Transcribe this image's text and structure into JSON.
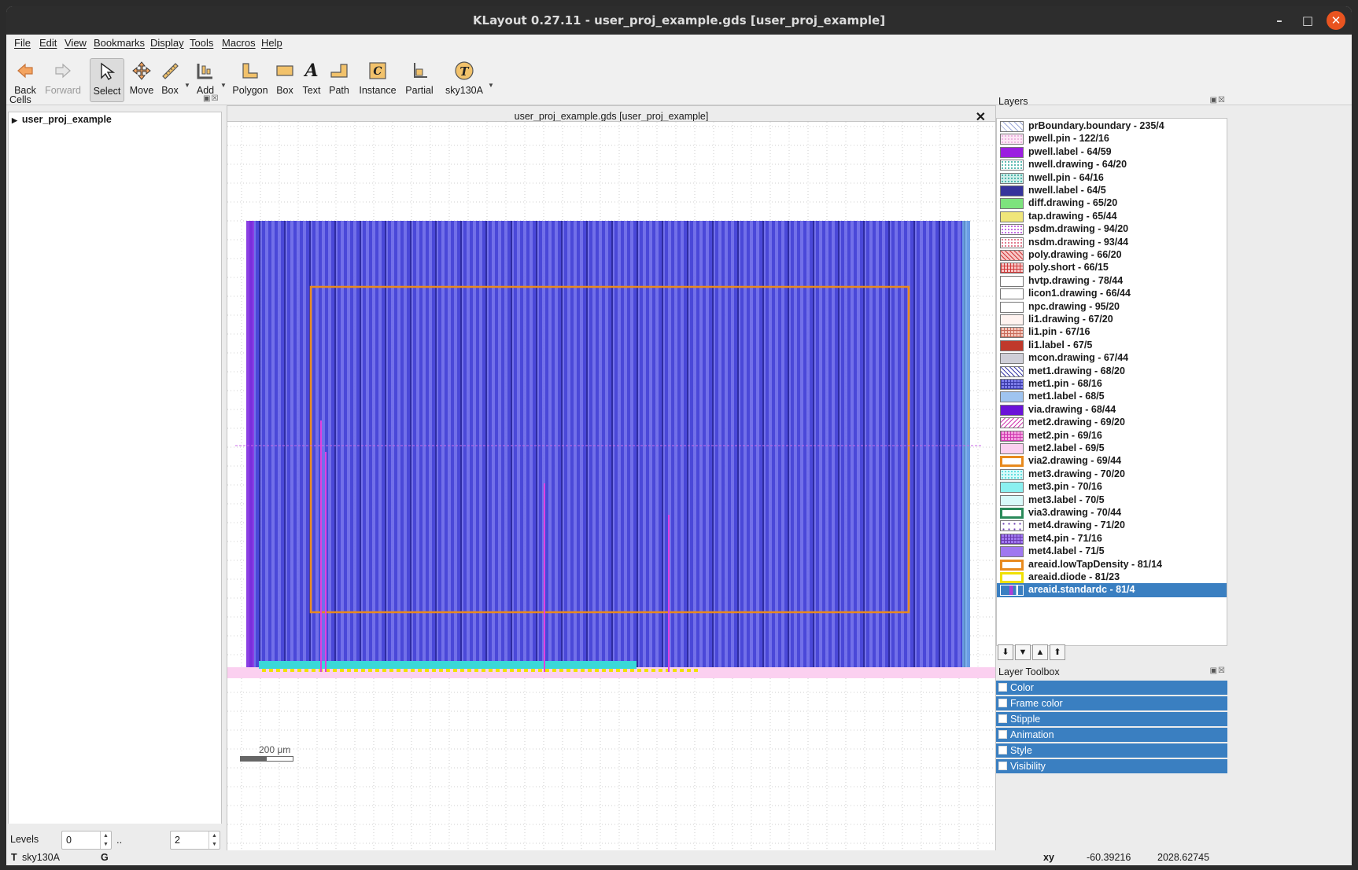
{
  "window": {
    "title": "KLayout 0.27.11 - user_proj_example.gds [user_proj_example]"
  },
  "menu": [
    "File",
    "Edit",
    "View",
    "Bookmarks",
    "Display",
    "Tools",
    "Macros",
    "Help"
  ],
  "toolbar": {
    "back": "Back",
    "forward": "Forward",
    "select": "Select",
    "move": "Move",
    "box": "Box",
    "add": "Add",
    "polygon": "Polygon",
    "box2": "Box",
    "text": "Text",
    "path": "Path",
    "instance": "Instance",
    "partial": "Partial",
    "tech": "sky130A"
  },
  "cells": {
    "title": "Cells",
    "root": "user_proj_example"
  },
  "levels": {
    "label": "Levels",
    "from": "0",
    "sep": "..",
    "to": "2"
  },
  "view": {
    "tab_title": "user_proj_example.gds [user_proj_example]",
    "scale_label": "200  μm"
  },
  "layers": {
    "title": "Layers",
    "items": [
      {
        "label": "prBoundary.boundary - 235/4",
        "fill": "#ffffff",
        "pattern": "diag-light",
        "color": "#9aa7d8"
      },
      {
        "label": "pwell.pin - 122/16",
        "fill": "#fde7f6",
        "pattern": "dots",
        "color": "#e8a6d8"
      },
      {
        "label": "pwell.label - 64/59",
        "fill": "#9b1ee0",
        "pattern": "solid",
        "color": "#9b1ee0"
      },
      {
        "label": "nwell.drawing - 64/20",
        "fill": "#ffffff",
        "pattern": "dots",
        "color": "#2aa59a"
      },
      {
        "label": "nwell.pin - 64/16",
        "fill": "#cdeee9",
        "pattern": "dots",
        "color": "#2aa59a"
      },
      {
        "label": "nwell.label - 64/5",
        "fill": "#36339b",
        "pattern": "solid",
        "color": "#36339b"
      },
      {
        "label": "diff.drawing - 65/20",
        "fill": "#7de37d",
        "pattern": "solid",
        "color": "#2eaf2e"
      },
      {
        "label": "tap.drawing - 65/44",
        "fill": "#f0e67a",
        "pattern": "solid",
        "color": "#c8b43c"
      },
      {
        "label": "psdm.drawing - 94/20",
        "fill": "#ffffff",
        "pattern": "dots",
        "color": "#b23cd8"
      },
      {
        "label": "nsdm.drawing - 93/44",
        "fill": "#ffffff",
        "pattern": "dots",
        "color": "#d8506a"
      },
      {
        "label": "poly.drawing - 66/20",
        "fill": "#f7c6c6",
        "pattern": "diag",
        "color": "#d03a3a"
      },
      {
        "label": "poly.short - 66/15",
        "fill": "#f7c6c6",
        "pattern": "grid",
        "color": "#d03a3a"
      },
      {
        "label": "hvtp.drawing - 78/44",
        "fill": "#ffffff",
        "pattern": "solid",
        "color": "#e8a04a"
      },
      {
        "label": "licon1.drawing - 66/44",
        "fill": "#ffffff",
        "pattern": "solid",
        "color": "#f7f3b0"
      },
      {
        "label": "npc.drawing - 95/20",
        "fill": "#ffffff",
        "pattern": "solid",
        "color": "#d04a4a"
      },
      {
        "label": "li1.drawing - 67/20",
        "fill": "#fff3f0",
        "pattern": "solid",
        "color": "#f0d8d0"
      },
      {
        "label": "li1.pin - 67/16",
        "fill": "#f4c4b8",
        "pattern": "grid",
        "color": "#c86a5a"
      },
      {
        "label": "li1.label - 67/5",
        "fill": "#c0392b",
        "pattern": "solid",
        "color": "#c0392b"
      },
      {
        "label": "mcon.drawing - 67/44",
        "fill": "#cfcfd8",
        "pattern": "solid",
        "color": "#a0a0b0"
      },
      {
        "label": "met1.drawing - 68/20",
        "fill": "#ffffff",
        "pattern": "diag",
        "color": "#3a3aa8"
      },
      {
        "label": "met1.pin - 68/16",
        "fill": "#7c7ce8",
        "pattern": "grid",
        "color": "#3a3aa8"
      },
      {
        "label": "met1.label - 68/5",
        "fill": "#9fc4f0",
        "pattern": "solid",
        "color": "#6a9ad8"
      },
      {
        "label": "via.drawing - 68/44",
        "fill": "#6a12d8",
        "pattern": "solid",
        "color": "#4a0ab0"
      },
      {
        "label": "met2.drawing - 69/20",
        "fill": "#ffffff",
        "pattern": "diag-rev",
        "color": "#d03ab0"
      },
      {
        "label": "met2.pin - 69/16",
        "fill": "#f4a0e0",
        "pattern": "grid",
        "color": "#d03ab0"
      },
      {
        "label": "met2.label - 69/5",
        "fill": "#fbd0f0",
        "pattern": "solid",
        "color": "#f0a0d8"
      },
      {
        "label": "via2.drawing - 69/44",
        "fill": "#ffffff",
        "pattern": "frame",
        "color": "#e88a1e"
      },
      {
        "label": "met3.drawing - 70/20",
        "fill": "#d8fafa",
        "pattern": "dots",
        "color": "#3ad8d8"
      },
      {
        "label": "met3.pin - 70/16",
        "fill": "#8af0f0",
        "pattern": "solid",
        "color": "#3ad8d8"
      },
      {
        "label": "met3.label - 70/5",
        "fill": "#d8fafa",
        "pattern": "solid",
        "color": "#a0e8e8"
      },
      {
        "label": "via3.drawing - 70/44",
        "fill": "#ffffff",
        "pattern": "frame",
        "color": "#2a8a5a"
      },
      {
        "label": "met4.drawing - 71/20",
        "fill": "#ffffff",
        "pattern": "plus",
        "color": "#6a3ab0"
      },
      {
        "label": "met4.pin - 71/16",
        "fill": "#a078f0",
        "pattern": "grid",
        "color": "#6a3ab0"
      },
      {
        "label": "met4.label - 71/5",
        "fill": "#a078f0",
        "pattern": "solid",
        "color": "#8a5ae0"
      },
      {
        "label": "areaid.lowTapDensity - 81/14",
        "fill": "#ffffff",
        "pattern": "frame",
        "color": "#e88a1e"
      },
      {
        "label": "areaid.diode - 81/23",
        "fill": "#ffffff",
        "pattern": "frame",
        "color": "#f0e000"
      },
      {
        "label": "areaid.standardc - 81/4",
        "fill": "#3a7fc1",
        "pattern": "selected",
        "color": "#ffffff"
      }
    ]
  },
  "layer_toolbox": {
    "title": "Layer Toolbox",
    "items": [
      "Color",
      "Frame color",
      "Stipple",
      "Animation",
      "Style",
      "Visibility"
    ]
  },
  "status": {
    "t": "T",
    "tech": "sky130A",
    "g": "G",
    "xy": "xy",
    "x": "-60.39216",
    "y": "2028.62745"
  },
  "colors": {
    "accent": "#3a7fc1",
    "metal_stripe": "#4a48d8",
    "layout_fill": "#6a68e8",
    "frame": "#e88a1e"
  }
}
